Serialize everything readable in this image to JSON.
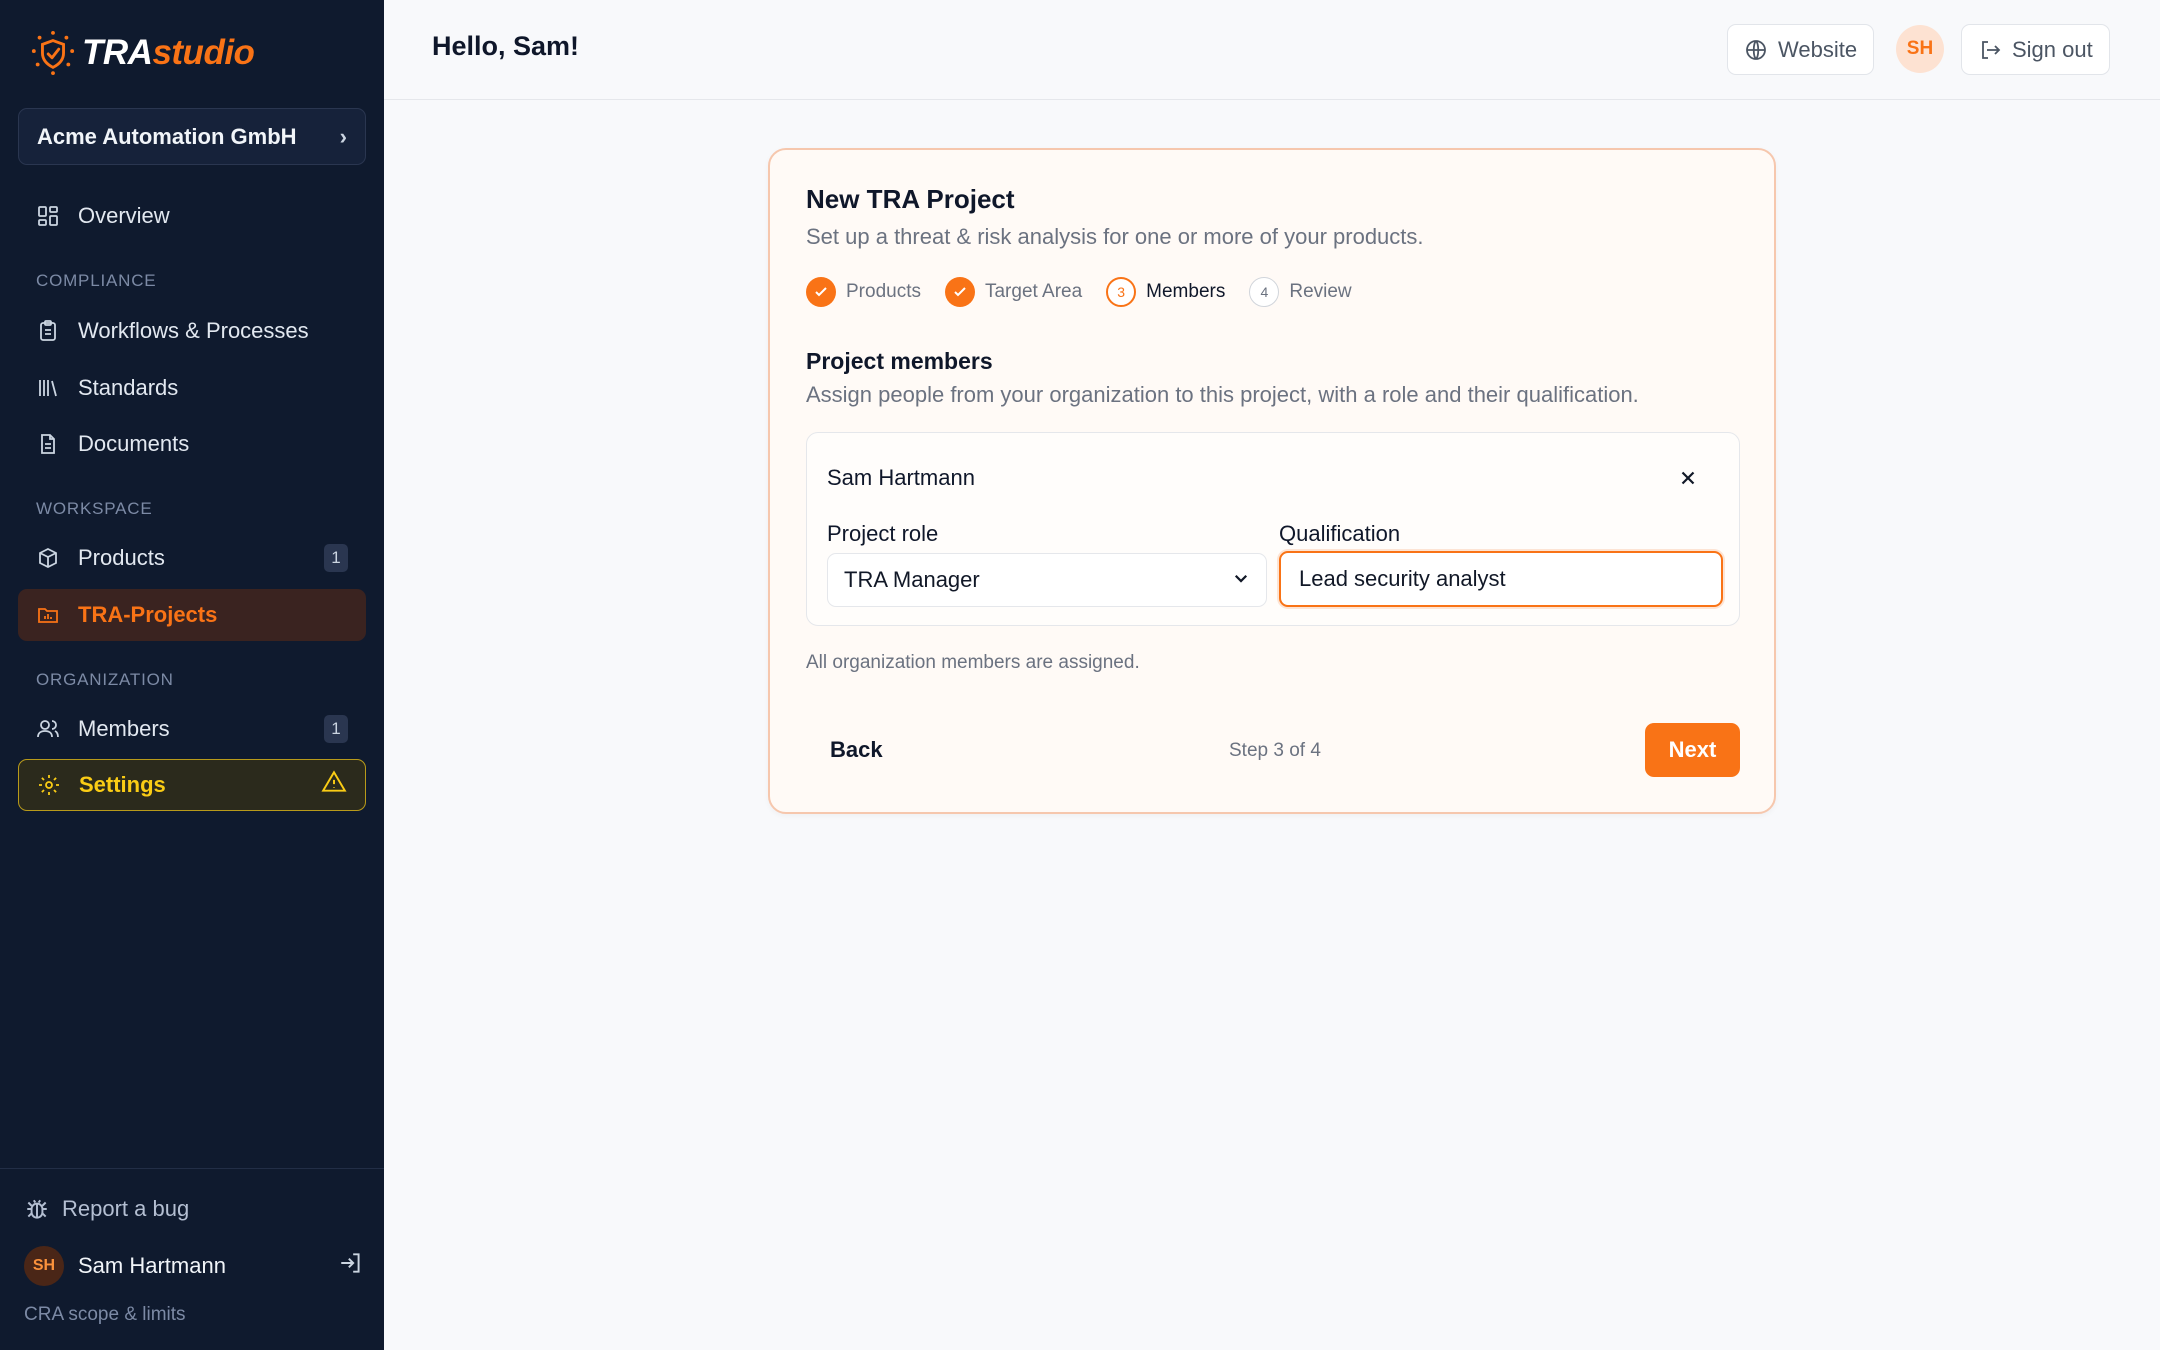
{
  "app": {
    "brand_tra": "TRA",
    "brand_studio": "studio"
  },
  "sidebar": {
    "org_name": "Acme Automation GmbH",
    "overview": "Overview",
    "sections": {
      "compliance": "COMPLIANCE",
      "workspace": "WORKSPACE",
      "organization": "ORGANIZATION"
    },
    "items": {
      "workflows": "Workflows & Processes",
      "standards": "Standards",
      "documents": "Documents",
      "products": "Products",
      "products_count": "1",
      "tra_projects": "TRA-Projects",
      "members": "Members",
      "members_count": "1",
      "settings": "Settings"
    },
    "report_bug": "Report a bug",
    "user_initials": "SH",
    "user_name": "Sam Hartmann",
    "cra_link": "CRA scope & limits"
  },
  "header": {
    "greeting": "Hello, Sam!",
    "website": "Website",
    "avatar_initials": "SH",
    "sign_out": "Sign out"
  },
  "wizard": {
    "title": "New TRA Project",
    "subtitle": "Set up a threat & risk analysis for one or more of your products.",
    "steps": [
      {
        "label": "Products",
        "state": "done"
      },
      {
        "label": "Target Area",
        "state": "done"
      },
      {
        "label": "Members",
        "state": "current",
        "number": "3"
      },
      {
        "label": "Review",
        "state": "todo",
        "number": "4"
      }
    ],
    "section_title": "Project members",
    "section_subtitle": "Assign people from your organization to this project, with a role and their qualification.",
    "member": {
      "name": "Sam Hartmann",
      "role_label": "Project role",
      "role_value": "TRA Manager",
      "qualification_label": "Qualification",
      "qualification_value": "Lead security analyst"
    },
    "assigned_note": "All organization members are assigned.",
    "back": "Back",
    "step_count": "Step 3 of 4",
    "next": "Next"
  },
  "colors": {
    "accent": "#f97316",
    "sidebar_bg": "#0f1a2e",
    "warning": "#facc15"
  }
}
